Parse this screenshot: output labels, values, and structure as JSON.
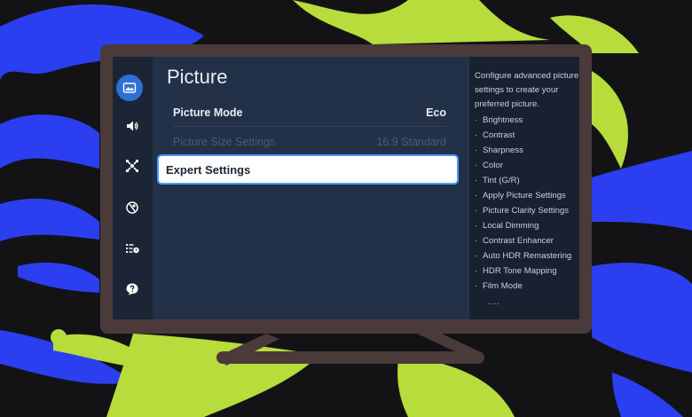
{
  "colors": {
    "accent_blue": "#2f6fd6",
    "highlight_border": "#4d9bff",
    "splash_green": "#b7dc3c",
    "splash_blue": "#2b3ff0"
  },
  "sidebar": {
    "icons": [
      "picture-icon",
      "sound-icon",
      "connection-icon",
      "support-icon",
      "accessibility-icon",
      "help-icon"
    ]
  },
  "main": {
    "title": "Picture",
    "rows": [
      {
        "label": "Picture Mode",
        "value": "Eco"
      },
      {
        "label": "Picture Size Settings",
        "value": "16:9 Standard"
      },
      {
        "label": "Expert Settings"
      }
    ]
  },
  "help": {
    "description": "Configure advanced picture settings to create your preferred picture.",
    "items": [
      "Brightness",
      "Contrast",
      "Sharpness",
      "Color",
      "Tint (G/R)",
      "Apply Picture Settings",
      "Picture Clarity Settings",
      "Local Dimming",
      "Contrast Enhancer",
      "Auto HDR Remastering",
      "HDR Tone Mapping",
      "Film Mode"
    ],
    "more": "...."
  }
}
